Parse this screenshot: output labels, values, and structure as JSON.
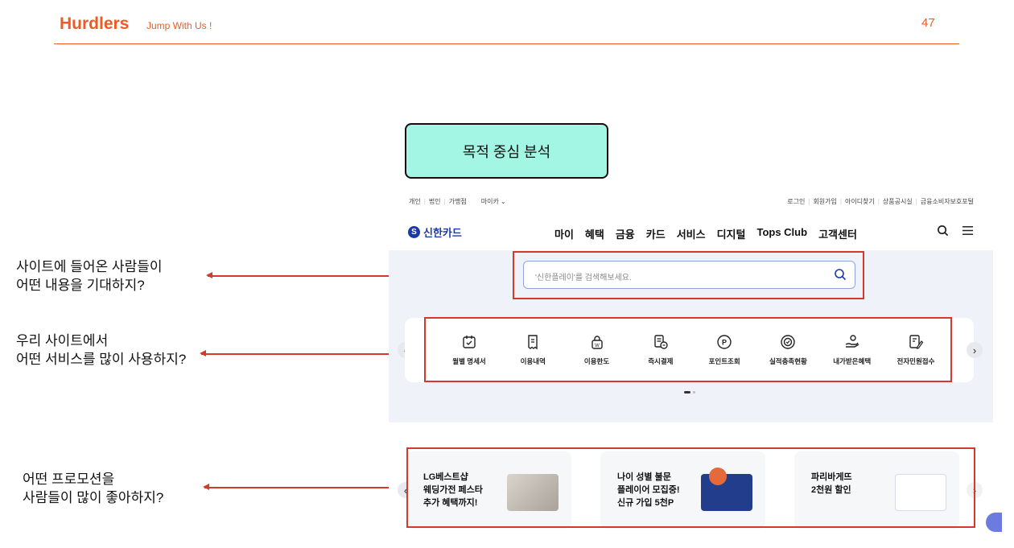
{
  "slide": {
    "brand": "Hurdlers",
    "tagline": "Jump With Us !",
    "page_number": "47",
    "title": "목적 중심 분석"
  },
  "notes": [
    {
      "lines": [
        "사이트에 들어온 사람들이",
        "어떤 내용을 기대하지?"
      ]
    },
    {
      "lines": [
        "우리 사이트에서",
        "어떤 서비스를 많이 사용하지?"
      ]
    },
    {
      "lines": [
        "어떤 프로모션을",
        "사람들이 많이 좋아하지?"
      ]
    }
  ],
  "site": {
    "top_left_links": [
      "개인",
      "법인",
      "가맹점"
    ],
    "mycar": "마이카",
    "top_right_links": [
      "로그인",
      "회원가입",
      "아이디찾기",
      "상품공시실",
      "금융소비자보호포털"
    ],
    "logo_text": "신한카드",
    "menu": [
      "마이",
      "혜택",
      "금융",
      "카드",
      "서비스",
      "디지털",
      "Tops Club",
      "고객센터"
    ],
    "search": {
      "placeholder": "'신한플레이'를 검색해보세요."
    },
    "services": [
      {
        "label": "월별 명세서",
        "icon": "calendar-check-icon"
      },
      {
        "label": "이용내역",
        "icon": "receipt-icon"
      },
      {
        "label": "이용한도",
        "icon": "lock-won-icon"
      },
      {
        "label": "즉시결제",
        "icon": "bill-pay-icon"
      },
      {
        "label": "포인트조회",
        "icon": "point-icon"
      },
      {
        "label": "실적충족현황",
        "icon": "progress-ring-icon"
      },
      {
        "label": "내가받은혜택",
        "icon": "hand-gift-icon"
      },
      {
        "label": "전자민원접수",
        "icon": "document-edit-icon"
      }
    ],
    "promos": [
      {
        "lines": [
          "LG베스트샵",
          "웨딩가전 페스타",
          "추가 혜택까지!"
        ]
      },
      {
        "lines": [
          "나이 성별 불문",
          "플레이어 모집중!",
          "신규 가입 5천P"
        ]
      },
      {
        "lines": [
          "파리바게뜨",
          "2천원 할인"
        ]
      }
    ]
  },
  "colors": {
    "accent": "#ee5a24",
    "annotation_red": "#d33a2c",
    "title_box": "#a3f5e4",
    "shinhan_blue": "#1b3aa8"
  }
}
